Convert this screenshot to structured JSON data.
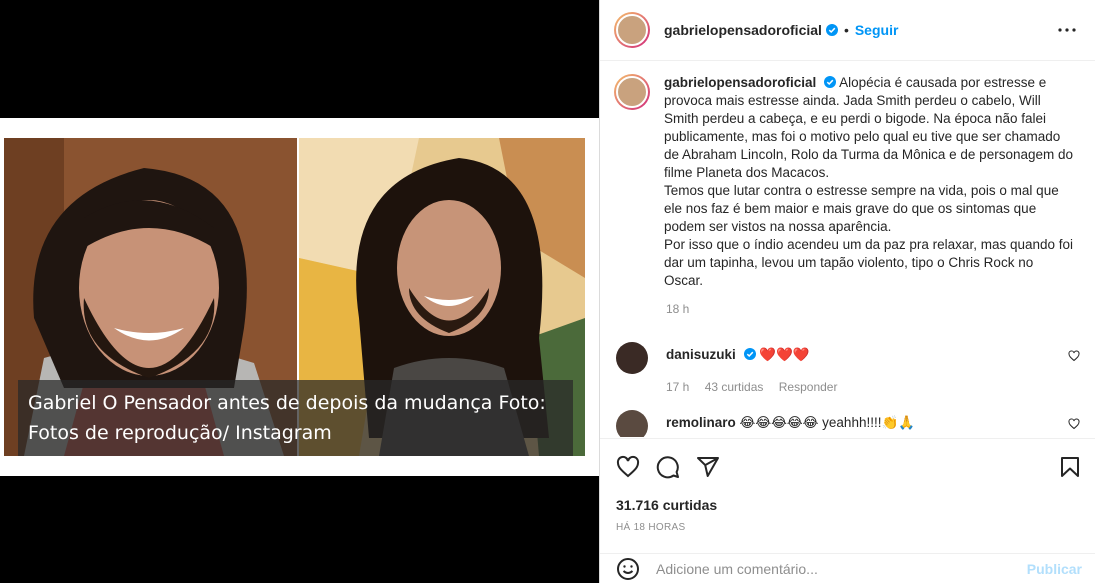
{
  "post": {
    "caption_overlay_line1": "Gabriel O Pensador antes de depois da mudança Foto:",
    "caption_overlay_line2": "Fotos de reprodução/ Instagram"
  },
  "header": {
    "username": "gabrielopensadoroficial",
    "separator": "•",
    "follow_label": "Seguir"
  },
  "caption": {
    "username": "gabrielopensadoroficial",
    "text_p1": "Alopécia é causada por estresse e provoca mais estresse ainda. Jada Smith perdeu o cabelo, Will Smith perdeu a cabeça, e eu perdi o bigode. Na época não falei publicamente, mas foi o motivo pelo qual eu tive que ser chamado de Abraham Lincoln, Rolo da Turma da Mônica e de personagem do filme Planeta dos Macacos.",
    "text_p2": "Temos que lutar contra o estresse sempre na vida, pois o mal que ele nos faz é bem maior e mais grave do que os sintomas que podem ser vistos na nossa aparência.",
    "text_p3": "Por isso que o índio acendeu um da paz pra relaxar, mas quando foi dar um tapinha, levou um tapão violento, tipo o Chris Rock no Oscar.",
    "time": "18 h"
  },
  "comments": [
    {
      "username": "danisuzuki",
      "text": "❤️❤️❤️",
      "time": "17 h",
      "likes": "43 curtidas",
      "reply": "Responder"
    },
    {
      "username": "remolinaro",
      "text": "😂😂😂😂😂 yeahhh!!!!👏🙏"
    }
  ],
  "footer": {
    "likes": "31.716 curtidas",
    "time": "HÁ 18 HORAS",
    "comment_placeholder": "Adicione um comentário...",
    "publish_label": "Publicar"
  },
  "colors": {
    "accent": "#0095f6",
    "heart": "#ed4956",
    "publish_disabled": "#b2dffc"
  }
}
